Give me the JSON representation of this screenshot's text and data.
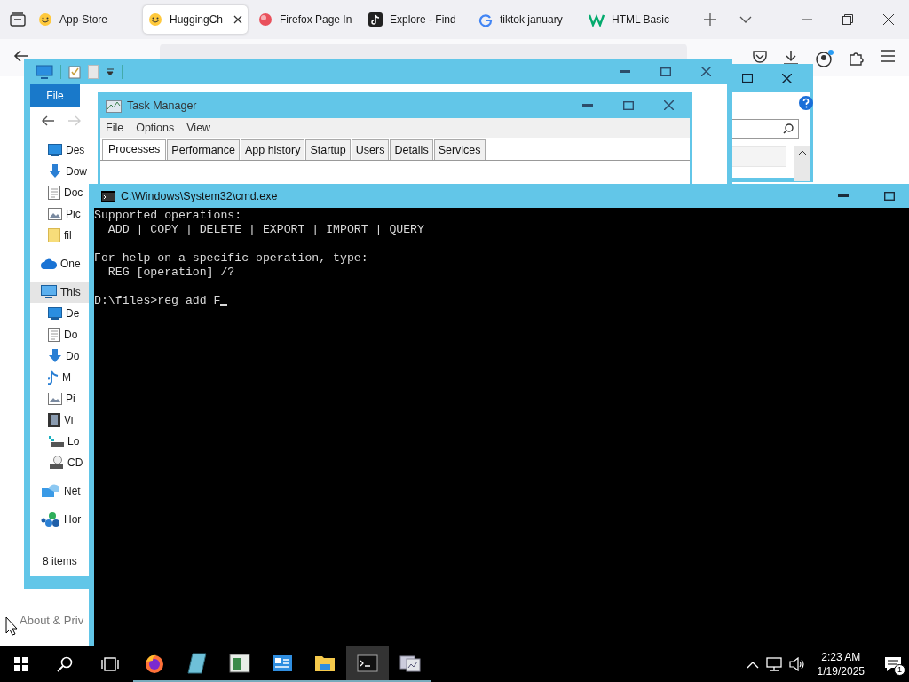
{
  "browser": {
    "tabs": [
      {
        "label": "App-Store",
        "selected": false,
        "kind": "smiley"
      },
      {
        "label": "HuggingCh",
        "selected": true,
        "kind": "smiley"
      },
      {
        "label": "Firefox Page In",
        "selected": false,
        "kind": "ball"
      },
      {
        "label": "Explore - Find",
        "selected": false,
        "kind": "note"
      },
      {
        "label": "tiktok january",
        "selected": false,
        "kind": "g"
      },
      {
        "label": "HTML Basic",
        "selected": false,
        "kind": "w"
      }
    ],
    "page_text": "About & Priv"
  },
  "explorer": {
    "ribbon_tab": "File",
    "status": "8 items",
    "nav": [
      {
        "label": "Des",
        "kind": "desktop",
        "selected": false
      },
      {
        "label": "Dow",
        "kind": "download",
        "selected": false
      },
      {
        "label": "Doc",
        "kind": "document",
        "selected": false
      },
      {
        "label": "Pic",
        "kind": "picture",
        "selected": false
      },
      {
        "label": "fil",
        "kind": "folder",
        "selected": false
      },
      {
        "label": "One",
        "kind": "cloud",
        "selected": false
      },
      {
        "label": "This",
        "kind": "pc",
        "selected": true,
        "children": [
          {
            "label": "De",
            "kind": "desktop",
            "selected": false
          },
          {
            "label": "Do",
            "kind": "document",
            "selected": false
          },
          {
            "label": "Do",
            "kind": "download",
            "selected": false
          },
          {
            "label": "M",
            "kind": "music",
            "selected": false
          },
          {
            "label": "Pi",
            "kind": "picture",
            "selected": false
          },
          {
            "label": "Vi",
            "kind": "video",
            "selected": false
          },
          {
            "label": "Lo",
            "kind": "drive",
            "selected": false
          },
          {
            "label": "CD",
            "kind": "disc",
            "selected": false
          }
        ]
      },
      {
        "label": "Net",
        "kind": "network",
        "selected": false
      },
      {
        "label": "Hor",
        "kind": "homegroup",
        "selected": false
      }
    ]
  },
  "task_manager": {
    "title": "Task Manager",
    "menu": [
      "File",
      "Options",
      "View"
    ],
    "tabs": [
      {
        "label": "Processes",
        "selected": true
      },
      {
        "label": "Performance",
        "selected": false
      },
      {
        "label": "App history",
        "selected": false
      },
      {
        "label": "Startup",
        "selected": false
      },
      {
        "label": "Users",
        "selected": false
      },
      {
        "label": "Details",
        "selected": false
      },
      {
        "label": "Services",
        "selected": false
      }
    ]
  },
  "cmd": {
    "title": "C:\\Windows\\System32\\cmd.exe",
    "blocks": [
      [
        "Supported operations:",
        "  ADD | COPY | DELETE | EXPORT | IMPORT | QUERY"
      ],
      [
        "For help on a specific operation, type:",
        "  REG [operation] /?"
      ]
    ],
    "prompt": "D:\\files>reg add F"
  },
  "taskbar": {
    "apps": [
      {
        "kind": "firefox",
        "active": false
      },
      {
        "kind": "notepad",
        "active": false
      },
      {
        "kind": "window",
        "active": false
      },
      {
        "kind": "panel",
        "active": false
      },
      {
        "kind": "folder",
        "active": false
      },
      {
        "kind": "terminal",
        "active": true
      },
      {
        "kind": "server",
        "active": false
      }
    ],
    "time": "2:23 AM",
    "date": "1/19/2025",
    "notifications": "1"
  }
}
